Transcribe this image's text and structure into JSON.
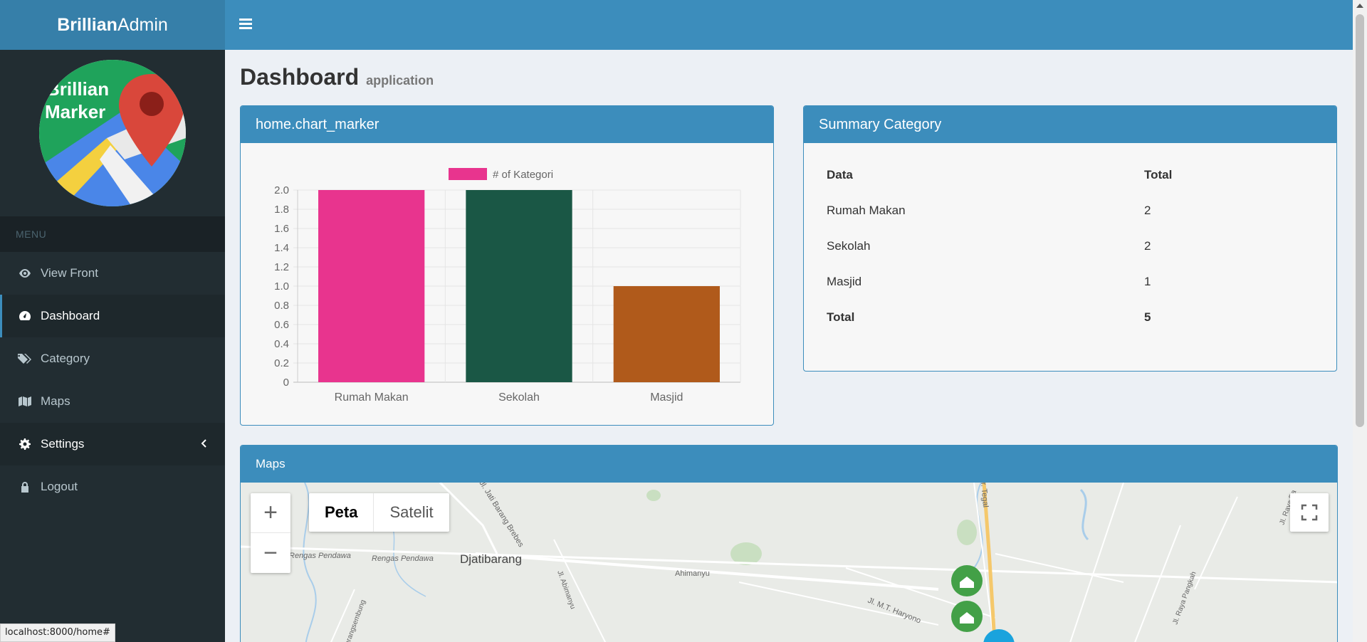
{
  "brand": {
    "bold": "Brillian",
    "light": "Admin"
  },
  "logo_text": {
    "line1": "Brillian",
    "line2": "Marker"
  },
  "menu": {
    "header": "MENU",
    "items": [
      {
        "label": "View Front",
        "icon": "eye-icon"
      },
      {
        "label": "Dashboard",
        "icon": "dashboard-icon"
      },
      {
        "label": "Category",
        "icon": "tags-icon"
      },
      {
        "label": "Maps",
        "icon": "map-icon"
      },
      {
        "label": "Settings",
        "icon": "gear-icon"
      },
      {
        "label": "Logout",
        "icon": "lock-icon"
      }
    ]
  },
  "page": {
    "title": "Dashboard",
    "subtitle": "application"
  },
  "chart_box": {
    "title": "home.chart_marker"
  },
  "chart_data": {
    "type": "bar",
    "categories": [
      "Rumah Makan",
      "Sekolah",
      "Masjid"
    ],
    "series": [
      {
        "name": "# of Kategori",
        "values": [
          2,
          2,
          1
        ]
      }
    ],
    "colors": [
      "#e8348e",
      "#1a5745",
      "#b05a1b"
    ],
    "ylim": [
      0,
      2.0
    ],
    "yticks": [
      "0",
      "0.2",
      "0.4",
      "0.6",
      "0.8",
      "1.0",
      "1.2",
      "1.4",
      "1.6",
      "1.8",
      "2.0"
    ],
    "grid": true,
    "legend": "top"
  },
  "summary": {
    "title": "Summary Category",
    "header": {
      "data": "Data",
      "total": "Total"
    },
    "rows": [
      {
        "data": "Rumah Makan",
        "total": "2"
      },
      {
        "data": "Sekolah",
        "total": "2"
      },
      {
        "data": "Masjid",
        "total": "1"
      }
    ],
    "footer": {
      "data": "Total",
      "total": "5"
    }
  },
  "maps": {
    "title": "Maps",
    "zoom_in": "+",
    "zoom_out": "−",
    "type_map": "Peta",
    "type_satellite": "Satelit",
    "labels": {
      "town": "Djatibarang",
      "road1": "Rengas Pendawa",
      "road2": "Rengas Pendawa",
      "road3": "Jl. Jati Barang Brebes",
      "road4": "Ahimanyu",
      "road5": "Jl. Abimanyu",
      "road6": "Jl. M.T. Haryono",
      "road7": "Jl. Raya Pangkah",
      "road8": "Jl. Raya Ba",
      "road9": "Karangsembung",
      "road10": "r. Tegal"
    }
  },
  "status_url": "localhost:8000/home#"
}
